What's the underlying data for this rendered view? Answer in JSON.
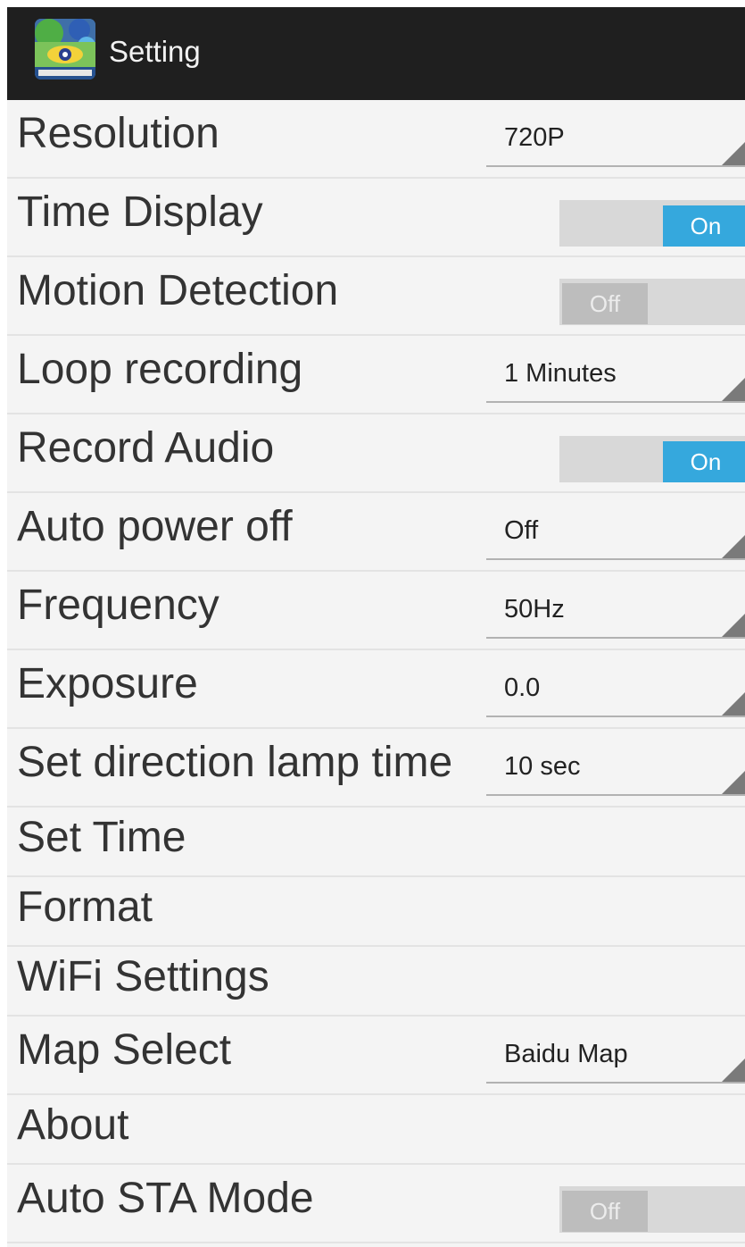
{
  "header": {
    "title": "Setting",
    "icon": "app-logo-icon"
  },
  "colors": {
    "action_bar": "#1f1f1f",
    "background": "#f4f4f4",
    "switch_on": "#35a8dd",
    "switch_track": "#d8d8d8"
  },
  "settings": {
    "resolution": {
      "label": "Resolution",
      "value": "720P"
    },
    "time_display": {
      "label": "Time Display",
      "state": "On"
    },
    "motion_detection": {
      "label": "Motion Detection",
      "state": "Off"
    },
    "loop_recording": {
      "label": "Loop recording",
      "value": "1 Minutes"
    },
    "record_audio": {
      "label": "Record Audio",
      "state": "On"
    },
    "auto_power_off": {
      "label": "Auto power off",
      "value": "Off"
    },
    "frequency": {
      "label": "Frequency",
      "value": "50Hz"
    },
    "exposure": {
      "label": "Exposure",
      "value": "0.0"
    },
    "direction_lamp_time": {
      "label": "Set direction lamp time",
      "value": "10 sec"
    },
    "set_time": {
      "label": "Set Time"
    },
    "format": {
      "label": "Format"
    },
    "wifi_settings": {
      "label": "WiFi Settings"
    },
    "map_select": {
      "label": "Map Select",
      "value": "Baidu Map"
    },
    "about": {
      "label": "About"
    },
    "auto_sta_mode": {
      "label": "Auto STA Mode",
      "state": "Off"
    }
  }
}
